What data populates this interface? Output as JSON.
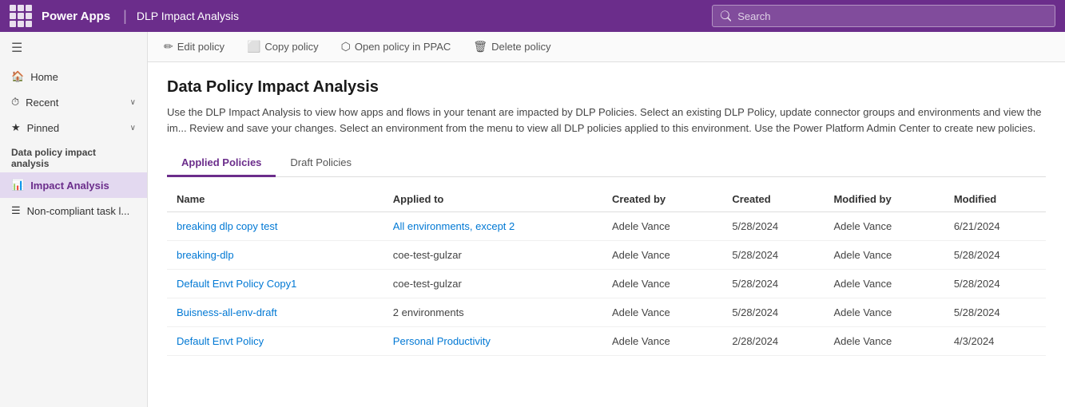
{
  "topNav": {
    "brand": "Power Apps",
    "separator": "|",
    "title": "DLP Impact Analysis",
    "search": {
      "placeholder": "Search"
    }
  },
  "toolbar": {
    "buttons": [
      {
        "id": "edit-policy",
        "label": "Edit policy",
        "icon": "✏"
      },
      {
        "id": "copy-policy",
        "label": "Copy policy",
        "icon": "⬜"
      },
      {
        "id": "open-ppac",
        "label": "Open policy in PPAC",
        "icon": "⬡"
      },
      {
        "id": "delete-policy",
        "label": "Delete policy",
        "icon": "🗑"
      }
    ]
  },
  "sidebar": {
    "hamburger": "☰",
    "items": [
      {
        "id": "home",
        "label": "Home",
        "icon": "⌂",
        "hasChevron": false
      },
      {
        "id": "recent",
        "label": "Recent",
        "icon": "⏱",
        "hasChevron": true
      },
      {
        "id": "pinned",
        "label": "Pinned",
        "icon": "★",
        "hasChevron": true
      }
    ],
    "sectionLabel": "Data policy impact analysis",
    "subItems": [
      {
        "id": "impact-analysis",
        "label": "Impact Analysis",
        "icon": "📊",
        "active": true
      },
      {
        "id": "non-compliant",
        "label": "Non-compliant task l...",
        "icon": "☰",
        "active": false
      }
    ]
  },
  "mainContent": {
    "title": "Data Policy Impact Analysis",
    "description": "Use the DLP Impact Analysis to view how apps and flows in your tenant are impacted by DLP Policies. Select an existing DLP Policy, update connector groups and environments and view the im... Review and save your changes. Select an environment from the menu to view all DLP policies applied to this environment. Use the Power Platform Admin Center to create new policies.",
    "tabs": [
      {
        "id": "applied",
        "label": "Applied Policies",
        "active": true
      },
      {
        "id": "draft",
        "label": "Draft Policies",
        "active": false
      }
    ],
    "table": {
      "columns": [
        {
          "id": "name",
          "label": "Name"
        },
        {
          "id": "appliedTo",
          "label": "Applied to"
        },
        {
          "id": "createdBy",
          "label": "Created by"
        },
        {
          "id": "created",
          "label": "Created"
        },
        {
          "id": "modifiedBy",
          "label": "Modified by"
        },
        {
          "id": "modified",
          "label": "Modified"
        }
      ],
      "rows": [
        {
          "name": "breaking dlp copy test",
          "appliedTo": "All environments, except 2",
          "createdBy": "Adele Vance",
          "created": "5/28/2024",
          "modifiedBy": "Adele Vance",
          "modified": "6/21/2024",
          "nameIsLink": true,
          "appliedToIsLink": true
        },
        {
          "name": "breaking-dlp",
          "appliedTo": "coe-test-gulzar",
          "createdBy": "Adele Vance",
          "created": "5/28/2024",
          "modifiedBy": "Adele Vance",
          "modified": "5/28/2024",
          "nameIsLink": true,
          "appliedToIsLink": false
        },
        {
          "name": "Default Envt Policy Copy1",
          "appliedTo": "coe-test-gulzar",
          "createdBy": "Adele Vance",
          "created": "5/28/2024",
          "modifiedBy": "Adele Vance",
          "modified": "5/28/2024",
          "nameIsLink": true,
          "appliedToIsLink": false
        },
        {
          "name": "Buisness-all-env-draft",
          "appliedTo": "2 environments",
          "createdBy": "Adele Vance",
          "created": "5/28/2024",
          "modifiedBy": "Adele Vance",
          "modified": "5/28/2024",
          "nameIsLink": true,
          "appliedToIsLink": false
        },
        {
          "name": "Default Envt Policy",
          "appliedTo": "Personal Productivity",
          "createdBy": "Adele Vance",
          "created": "2/28/2024",
          "modifiedBy": "Adele Vance",
          "modified": "4/3/2024",
          "nameIsLink": true,
          "appliedToIsLink": true
        }
      ]
    }
  }
}
